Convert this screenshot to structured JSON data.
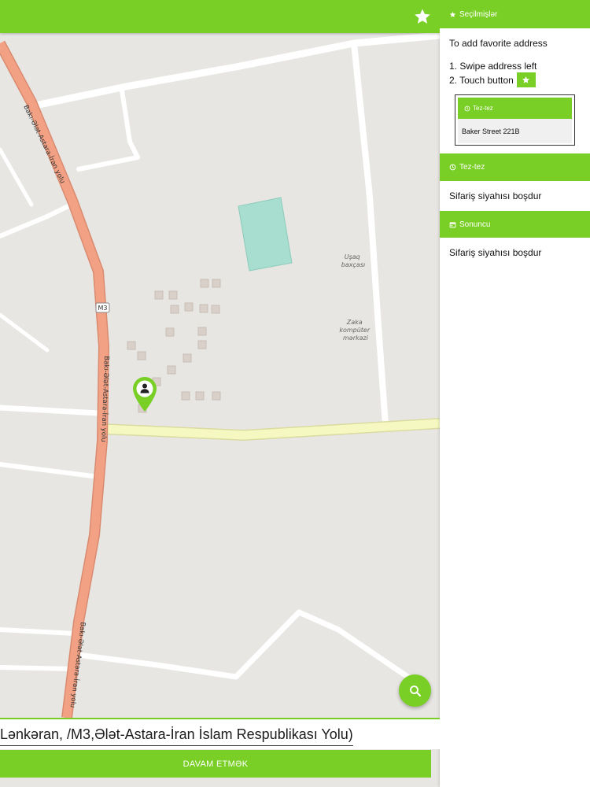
{
  "map": {
    "labels": {
      "road_upper": "Bakı-Ələt-Astara-İran yolu",
      "road_mid": "Bakı-Ələt-Astara-İran yolu",
      "road_lower": "Bakı-Ələt-Astara-İran yolu",
      "road_shield": "M3",
      "poi_kindergarten_line1": "Uşaq",
      "poi_kindergarten_line2": "baxçası",
      "poi_computer_line1": "Zaka",
      "poi_computer_line2": "kompüter",
      "poi_computer_line3": "mərkəzi"
    }
  },
  "address": {
    "value": "Lənkəran, /M3,Ələt-Astara-İran İslam Respublikası Yolu)"
  },
  "actions": {
    "continue_label": "DAVAM ETMƏK"
  },
  "icons": {
    "favorite": "star-icon",
    "search": "search-icon",
    "location_pin": "location-pin-icon",
    "person": "person-icon",
    "frequent": "clock-icon",
    "recent": "calendar-icon"
  },
  "colors": {
    "accent": "#79cf26",
    "road_primary": "#f2a184",
    "road_secondary": "#f5f8c0",
    "park": "#a8ded0"
  },
  "sidebar": {
    "favorites": {
      "title": "Seçilmişlər",
      "intro": "To add favorite address",
      "step1": "1. Swipe address left",
      "step2": "2. Touch button",
      "example_header": "Tez-tez",
      "example_address": "Baker Street 221B"
    },
    "frequent": {
      "title": "Tez-tez",
      "empty": "Sifariş siyahısı boşdur"
    },
    "recent": {
      "title": "Sonuncu",
      "empty": "Sifariş siyahısı boşdur"
    }
  }
}
